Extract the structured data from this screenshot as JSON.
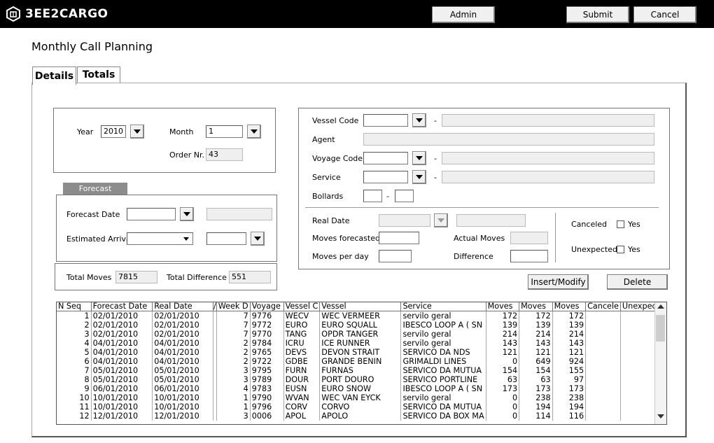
{
  "header": {
    "brand": "3EE2CARGO",
    "admin_label": "Admin",
    "submit_label": "Submit",
    "cancel_label": "Cancel"
  },
  "page": {
    "title": "Monthly Call Planning",
    "tabs": [
      "Details",
      "Totals"
    ]
  },
  "period": {
    "year_label": "Year",
    "year_value": "2010",
    "month_label": "Month",
    "month_value": "1",
    "order_label": "Order Nr.",
    "order_value": "43"
  },
  "forecast": {
    "section_label": "Forecast",
    "date_label": "Forecast Date",
    "date_value": "",
    "arrival_label": "Estimated Arrival",
    "arrival_value": ""
  },
  "totals": {
    "moves_label": "Total Moves",
    "moves_value": "7815",
    "diff_label": "Total Difference",
    "diff_value": "551"
  },
  "vessel": {
    "code_label": "Vessel Code",
    "agent_label": "Agent",
    "voyage_label": "Voyage Code",
    "service_label": "Service",
    "bollards_label": "Bollards",
    "real_date_label": "Real Date",
    "moves_forecasted_label": "Moves forecasted",
    "moves_per_day_label": "Moves per day",
    "actual_moves_label": "Actual Moves",
    "difference_label": "Difference",
    "canceled_label": "Canceled",
    "unexpected_label": "Unexpected",
    "yes_label": "Yes"
  },
  "actions": {
    "insert_label": "Insert/Modify",
    "delete_label": "Delete"
  },
  "grid": {
    "columns": [
      "N Seq",
      "Forecast Date",
      "Real Date",
      "/",
      "Week D",
      "Voyage",
      "Vessel C",
      "Vessel",
      "Service",
      "Moves",
      "Moves",
      "Moves",
      "Cancele",
      "Unexpecte"
    ],
    "rows": [
      [
        "1",
        "02/01/2010",
        "02/01/2010",
        "",
        "7",
        "9776",
        "WECV",
        "WEC VERMEER",
        "servilo geral",
        "172",
        "172",
        "172",
        "",
        ""
      ],
      [
        "2",
        "02/01/2010",
        "02/01/2010",
        "",
        "7",
        "9772",
        "EURO",
        "EURO SQUALL",
        "IBESCO LOOP A ( SN",
        "139",
        "139",
        "139",
        "",
        ""
      ],
      [
        "3",
        "02/01/2010",
        "02/01/2010",
        "",
        "7",
        "9770",
        "TANG",
        "OPDR TANGER",
        "servilo geral",
        "214",
        "214",
        "214",
        "",
        ""
      ],
      [
        "4",
        "04/01/2010",
        "04/01/2010",
        "",
        "2",
        "9784",
        "ICRU",
        "ICE RUNNER",
        "servilo geral",
        "143",
        "143",
        "143",
        "",
        ""
      ],
      [
        "5",
        "04/01/2010",
        "04/01/2010",
        "",
        "2",
        "9765",
        "DEVS",
        "DEVON STRAIT",
        "SERVICO DA NDS",
        "121",
        "121",
        "121",
        "",
        ""
      ],
      [
        "6",
        "04/01/2010",
        "04/01/2010",
        "",
        "2",
        "9722",
        "GDBE",
        "GRANDE BENIN",
        "GRIMALDI LINES",
        "0",
        "649",
        "924",
        "",
        ""
      ],
      [
        "7",
        "05/01/2010",
        "05/01/2010",
        "",
        "3",
        "9795",
        "FURN",
        "FURNAS",
        "SERVICO DA MUTUA",
        "154",
        "154",
        "155",
        "",
        ""
      ],
      [
        "8",
        "05/01/2010",
        "05/01/2010",
        "",
        "3",
        "9789",
        "DOUR",
        "PORT DOURO",
        "SERVICO PORTLINE",
        "63",
        "63",
        "97",
        "",
        ""
      ],
      [
        "9",
        "06/01/2010",
        "06/01/2010",
        "",
        "4",
        "9783",
        "EUSN",
        "EURO SNOW",
        "IBESCO LOOP A ( SN",
        "173",
        "173",
        "173",
        "",
        ""
      ],
      [
        "10",
        "10/01/2010",
        "10/01/2010",
        "",
        "1",
        "9790",
        "WVAN",
        "WEC VAN EYCK",
        "servilo geral",
        "0",
        "238",
        "238",
        "",
        ""
      ],
      [
        "11",
        "10/01/2010",
        "10/01/2010",
        "",
        "1",
        "9796",
        "CORV",
        "CORVO",
        "SERVICO DA MUTUA",
        "0",
        "194",
        "194",
        "",
        ""
      ],
      [
        "12",
        "12/01/2010",
        "12/01/2010",
        "",
        "3",
        "0006",
        "APOL",
        "APOLO",
        "SERVICO DA BOX MA",
        "0",
        "114",
        "116",
        "",
        ""
      ]
    ]
  }
}
